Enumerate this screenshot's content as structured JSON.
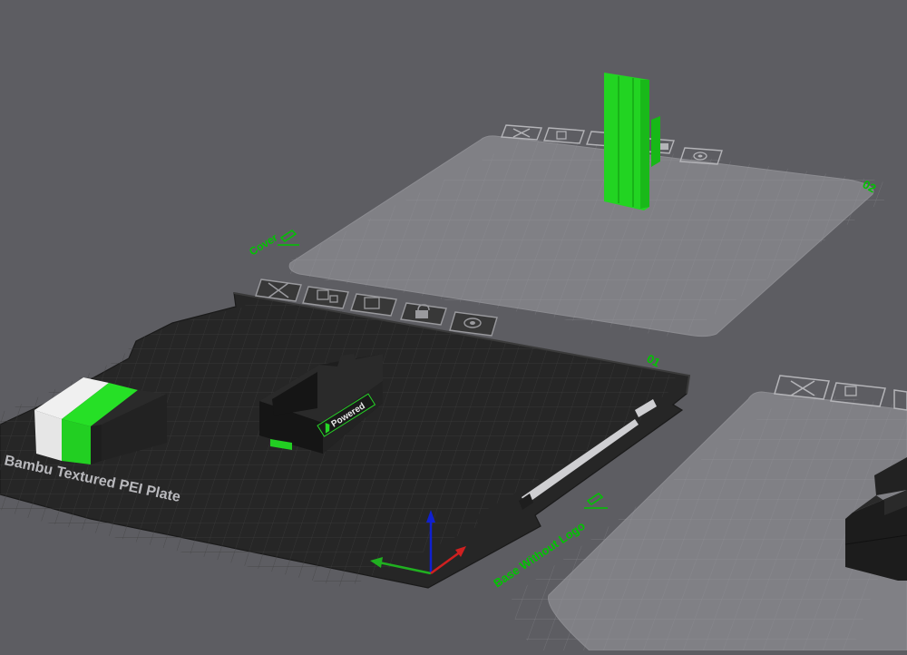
{
  "scene": {
    "background": "#5d5d62",
    "accent": "#00c400"
  },
  "plates": [
    {
      "index": "01",
      "name": "",
      "bed_label": "Bambu Textured PEI Plate",
      "active": true,
      "toolbar": [
        "close-icon",
        "arrange-icon",
        "orient-icon",
        "lock-icon",
        "settings-icon"
      ]
    },
    {
      "index": "02",
      "name": "Cover",
      "active": false,
      "toolbar": [
        "close-icon",
        "arrange-icon",
        "orient-icon",
        "lock-icon",
        "settings-icon"
      ]
    },
    {
      "index": "03",
      "name": "Base Without Logo",
      "active": false,
      "toolbar": [
        "close-icon",
        "arrange-icon",
        "orient-icon"
      ]
    }
  ],
  "objects": {
    "base_logo_text": "Powered"
  },
  "colors": {
    "green": "#1fd11f",
    "black": "#1e1e1e",
    "white": "#e8e8e8",
    "axis_x": "#d02020",
    "axis_y": "#20b020",
    "axis_z": "#1020d0"
  }
}
